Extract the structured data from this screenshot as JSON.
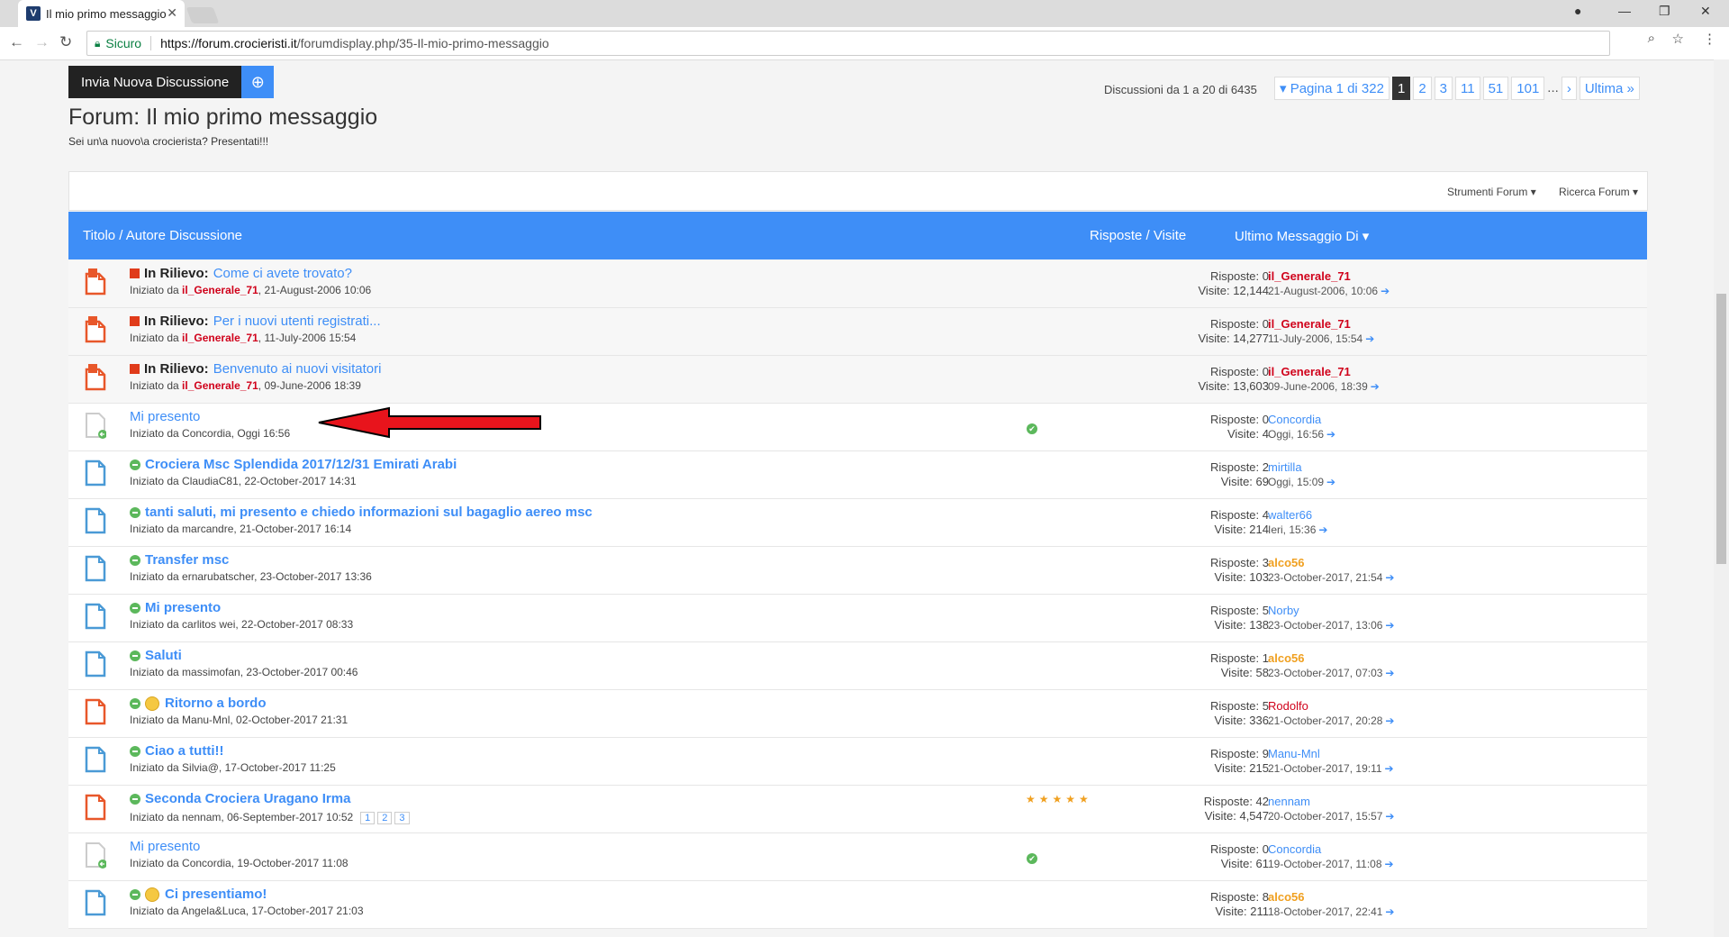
{
  "browser": {
    "tab_title": "Il mio primo messaggio",
    "secure_label": "Sicuro",
    "url_host": "https://forum.crocieristi.it",
    "url_path": "/forumdisplay.php/35-Il-mio-primo-messaggio"
  },
  "page": {
    "new_discussion_label": "Invia Nuova Discussione",
    "forum_title": "Forum: Il mio primo messaggio",
    "forum_description": "Sei un\\a nuovo\\a crocierista? Presentati!!!",
    "discussions_count": "Discussioni da 1 a 20 di 6435",
    "pagination": {
      "page_label": "Pagina 1 di 322",
      "pages": [
        "1",
        "2",
        "3",
        "11",
        "51",
        "101"
      ],
      "current": "1",
      "ellipsis": "...",
      "next": "›",
      "last": "Ultima »",
      "prev": "▾"
    },
    "tools": {
      "forum_tools": "Strumenti Forum ▾",
      "search_forum": "Ricerca Forum ▾"
    },
    "table_header": {
      "title_author": "Titolo / Autore Discussione",
      "replies_views": "Risposte / Visite",
      "last_post": "Ultimo Messaggio Di ▾"
    }
  },
  "threads": [
    {
      "sticky": true,
      "prefix": "In Rilievo:",
      "title": "Come ci avete trovato?",
      "starter_label": "Iniziato da ",
      "starter": "il_Generale_71",
      "started": ", 21-August-2006 10:06",
      "replies": "Risposte: 0",
      "views": "Visite: 12,144",
      "last_user": "il_Generale_71",
      "last_date": "21-August-2006, 10:06"
    },
    {
      "sticky": true,
      "prefix": "In Rilievo:",
      "title": "Per i nuovi utenti registrati...",
      "starter_label": "Iniziato da ",
      "starter": "il_Generale_71",
      "started": ", 11-July-2006 15:54",
      "replies": "Risposte: 0",
      "views": "Visite: 14,277",
      "last_user": "il_Generale_71",
      "last_date": "11-July-2006, 15:54"
    },
    {
      "sticky": true,
      "prefix": "In Rilievo:",
      "title": "Benvenuto ai nuovi visitatori",
      "starter_label": "Iniziato da ",
      "starter": "il_Generale_71",
      "started": ", 09-June-2006 18:39",
      "replies": "Risposte: 0",
      "views": "Visite: 13,603",
      "last_user": "il_Generale_71",
      "last_date": "09-June-2006, 18:39"
    },
    {
      "title": "Mi presento",
      "starter_text": "Iniziato da Concordia, Oggi 16:56",
      "replies": "Risposte: 0",
      "views": "Visite: 4",
      "last_user": "Concordia",
      "last_date": "Oggi, 16:56"
    },
    {
      "title": "Crociera Msc Splendida 2017/12/31 Emirati Arabi",
      "starter_text": "Iniziato da ClaudiaC81, 22-October-2017 14:31",
      "replies": "Risposte: 2",
      "views": "Visite: 69",
      "last_user": "mirtilla",
      "last_date": "Oggi, 15:09"
    },
    {
      "title": "tanti saluti, mi presento e chiedo informazioni sul bagaglio aereo msc",
      "starter_text": "Iniziato da marcandre, 21-October-2017 16:14",
      "replies": "Risposte: 4",
      "views": "Visite: 214",
      "last_user": "walter66",
      "last_date": "Ieri, 15:36"
    },
    {
      "title": "Transfer msc",
      "starter_text": "Iniziato da ernarubatscher, 23-October-2017 13:36",
      "replies": "Risposte: 3",
      "views": "Visite: 103",
      "last_user": "alco56",
      "last_date": "23-October-2017, 21:54"
    },
    {
      "title": "Mi presento",
      "starter_text": "Iniziato da carlitos wei, 22-October-2017 08:33",
      "replies": "Risposte: 5",
      "views": "Visite: 138",
      "last_user": "Norby",
      "last_date": "23-October-2017, 13:06"
    },
    {
      "title": "Saluti",
      "starter_text": "Iniziato da massimofan, 23-October-2017 00:46",
      "replies": "Risposte: 1",
      "views": "Visite: 58",
      "last_user": "alco56",
      "last_date": "23-October-2017, 07:03"
    },
    {
      "title": "Ritorno a bordo",
      "starter_text": "Iniziato da Manu-Mnl, 02-October-2017 21:31",
      "replies": "Risposte: 5",
      "views": "Visite: 336",
      "last_user": "Rodolfo",
      "last_date": "21-October-2017, 20:28"
    },
    {
      "title": "Ciao a tutti!!",
      "starter_text": "Iniziato da Silvia@, 17-October-2017 11:25",
      "replies": "Risposte: 9",
      "views": "Visite: 215",
      "last_user": "Manu-Mnl",
      "last_date": "21-October-2017, 19:11"
    },
    {
      "title": "Seconda Crociera Uragano Irma",
      "starter_text": "Iniziato da nennam, 06-September-2017 10:52",
      "pages": [
        "1",
        "2",
        "3"
      ],
      "rating": "★★★★★",
      "replies": "Risposte: 42",
      "views": "Visite: 4,547",
      "last_user": "nennam",
      "last_date": "20-October-2017, 15:57"
    },
    {
      "title": "Mi presento",
      "starter_text": "Iniziato da Concordia, 19-October-2017 11:08",
      "replies": "Risposte: 0",
      "views": "Visite: 61",
      "last_user": "Concordia",
      "last_date": "19-October-2017, 11:08"
    },
    {
      "title": "Ci presentiamo!",
      "starter_text": "Iniziato da Angela&Luca, 17-October-2017 21:03",
      "replies": "Risposte: 8",
      "views": "Visite: 211",
      "last_user": "alco56",
      "last_date": "18-October-2017, 22:41"
    }
  ],
  "colors": {
    "accent": "#3e8ef7",
    "header_blue": "#3e8ef7",
    "admin_red": "#d0021b",
    "hot_orange": "#e8572a",
    "user_orange": "#f0a020",
    "new_green": "#5cb85c",
    "arrow_red": "#e8141c"
  }
}
